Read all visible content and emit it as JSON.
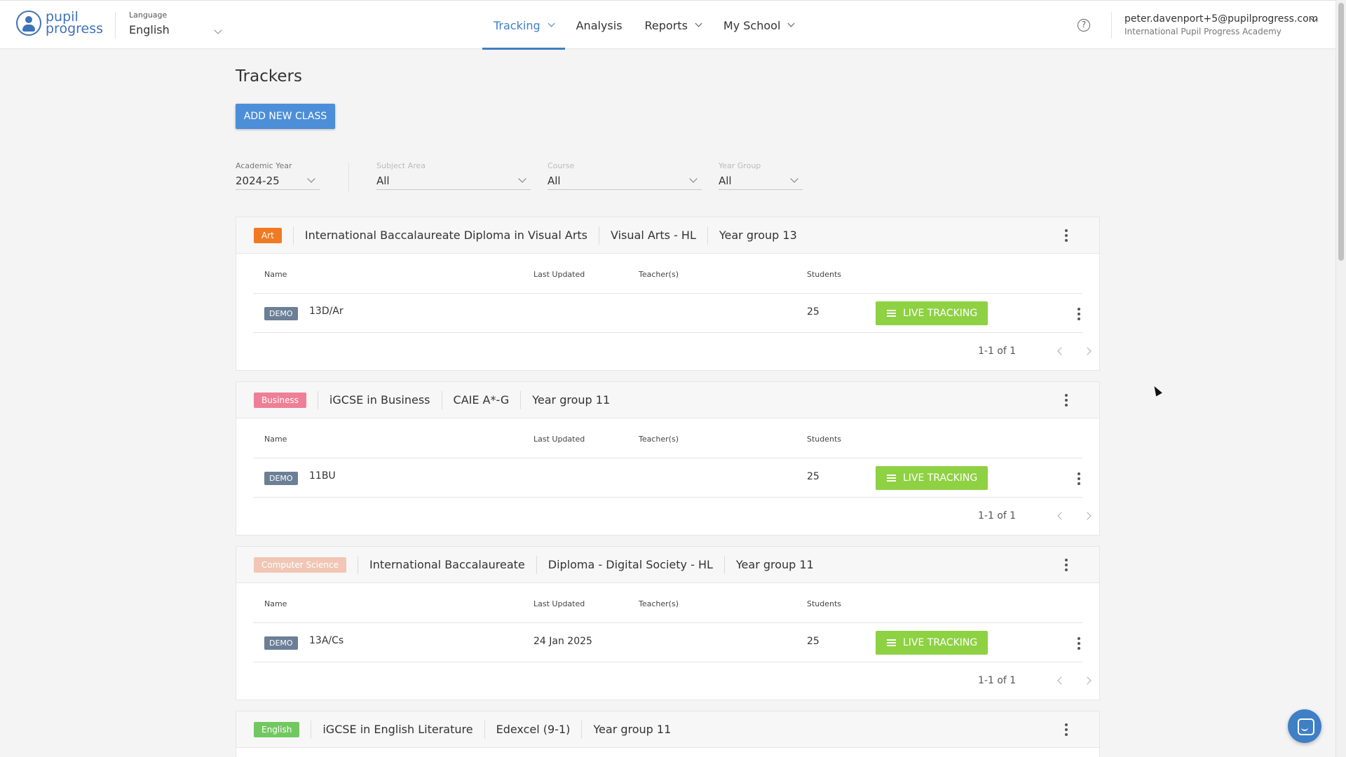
{
  "header": {
    "logo_text_line1": "pupil",
    "logo_text_line2": "progress",
    "language_label": "Language",
    "language_value": "English",
    "nav": [
      {
        "label": "Tracking",
        "has_dropdown": true,
        "active": true
      },
      {
        "label": "Analysis",
        "has_dropdown": false,
        "active": false
      },
      {
        "label": "Reports",
        "has_dropdown": true,
        "active": false
      },
      {
        "label": "My School",
        "has_dropdown": true,
        "active": false
      }
    ],
    "help_icon": "?",
    "user_email": "peter.davenport+5@pupilprogress.com",
    "user_school": "International Pupil Progress Academy"
  },
  "page": {
    "title": "Trackers",
    "add_button": "ADD NEW CLASS"
  },
  "filters": [
    {
      "label": "Academic Year",
      "value": "2024-25"
    },
    {
      "label": "Subject Area",
      "value": "All"
    },
    {
      "label": "Course",
      "value": "All"
    },
    {
      "label": "Year Group",
      "value": "All"
    }
  ],
  "table_headers": {
    "name": "Name",
    "last_updated": "Last Updated",
    "teachers": "Teacher(s)",
    "students": "Students"
  },
  "cards": [
    {
      "subject": "Art",
      "subject_color": "#f07a22",
      "segments": [
        "International Baccalaureate Diploma in Visual Arts",
        "Visual Arts - HL",
        "Year group 13"
      ],
      "rows": [
        {
          "badge": "DEMO",
          "name": "13D/Ar",
          "last_updated": "",
          "teachers": "",
          "students": "25",
          "action": "LIVE TRACKING"
        }
      ],
      "pager": "1-1 of 1"
    },
    {
      "subject": "Business",
      "subject_color": "#ef7f96",
      "segments": [
        "iGCSE in Business",
        "CAIE A*-G",
        "Year group 11"
      ],
      "rows": [
        {
          "badge": "DEMO",
          "name": "11BU",
          "last_updated": "",
          "teachers": "",
          "students": "25",
          "action": "LIVE TRACKING"
        }
      ],
      "pager": "1-1 of 1"
    },
    {
      "subject": "Computer Science",
      "subject_color": "#f1c6b4",
      "segments": [
        "International Baccalaureate",
        "Diploma - Digital Society - HL",
        "Year group 11"
      ],
      "rows": [
        {
          "badge": "DEMO",
          "name": "13A/Cs",
          "last_updated": "24 Jan 2025",
          "teachers": "",
          "students": "25",
          "action": "LIVE TRACKING"
        }
      ],
      "pager": "1-1 of 1"
    },
    {
      "subject": "English",
      "subject_color": "#72c860",
      "segments": [
        "iGCSE in English Literature",
        "Edexcel (9-1)",
        "Year group 11"
      ],
      "rows": [],
      "pager": ""
    }
  ],
  "colors": {
    "accent": "#3f7fc6",
    "add_button": "#4d8ed8",
    "live_tracking": "#8ed143",
    "demo_badge": "#6b7f96"
  },
  "icons": [
    "logo-icon",
    "chevron-down-icon",
    "help-icon",
    "kebab-menu-icon",
    "list-icon",
    "chevron-left-icon",
    "chevron-right-icon",
    "chat-icon",
    "mouse-cursor-icon"
  ]
}
